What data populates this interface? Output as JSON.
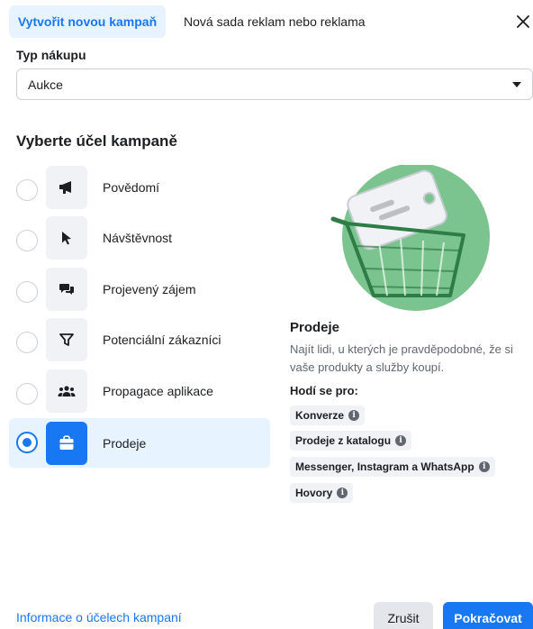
{
  "header": {
    "tab_active": "Vytvořit novou kampaň",
    "tab_inactive": "Nová sada reklam nebo reklama",
    "close_icon": "close-icon"
  },
  "purchase_type": {
    "label": "Typ nákupu",
    "value": "Aukce"
  },
  "objectives": {
    "title": "Vyberte účel kampaně",
    "items": [
      {
        "label": "Povědomí",
        "icon": "megaphone-icon",
        "selected": false
      },
      {
        "label": "Návštěvnost",
        "icon": "cursor-icon",
        "selected": false
      },
      {
        "label": "Projevený zájem",
        "icon": "chat-icon",
        "selected": false
      },
      {
        "label": "Potenciální zákazníci",
        "icon": "filter-icon",
        "selected": false
      },
      {
        "label": "Propagace aplikace",
        "icon": "people-icon",
        "selected": false
      },
      {
        "label": "Prodeje",
        "icon": "shopping-bag-icon",
        "selected": true
      }
    ]
  },
  "detail": {
    "title": "Prodeje",
    "description": "Najít lidi, u kterých je pravděpodobné, že si vaše produkty a služby koupí.",
    "suited_label": "Hodí se pro:",
    "chips": [
      "Konverze",
      "Prodeje z katalogu",
      "Messenger, Instagram a WhatsApp",
      "Hovory"
    ]
  },
  "footer": {
    "link": "Informace o účelech kampaní",
    "cancel": "Zrušit",
    "continue": "Pokračovat"
  },
  "colors": {
    "accent": "#1877f2",
    "selected_bg": "#e7f3ff",
    "illustration_green": "#7cc48f"
  }
}
